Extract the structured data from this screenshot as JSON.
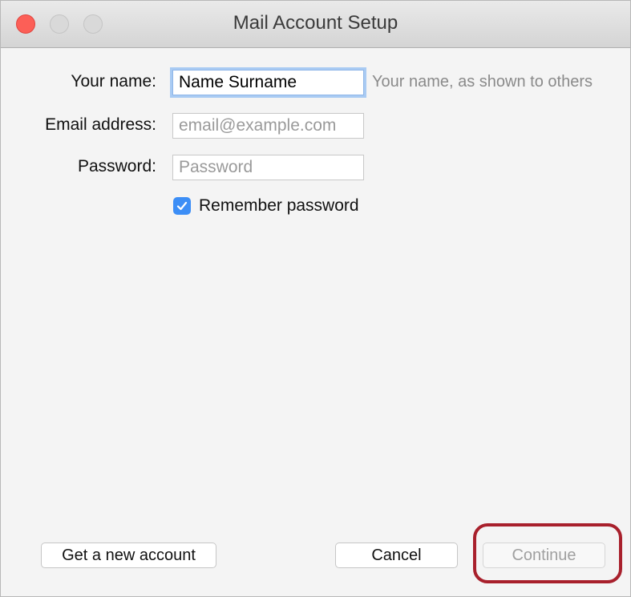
{
  "window": {
    "title": "Mail Account Setup"
  },
  "form": {
    "name": {
      "label": "Your name:",
      "value": "Name Surname",
      "hint": "Your name, as shown to others"
    },
    "email": {
      "label": "Email address:",
      "placeholder": "email@example.com"
    },
    "password": {
      "label": "Password:",
      "placeholder": "Password"
    },
    "remember": {
      "label": "Remember password",
      "checked": true
    }
  },
  "buttons": {
    "new_account": "Get a new account",
    "cancel": "Cancel",
    "continue": "Continue"
  },
  "colors": {
    "accent": "#3c8ef6",
    "close_button": "#fc5f57",
    "highlight_ring": "#a8202c"
  },
  "icons": {
    "checkbox": "checkmark-icon"
  }
}
